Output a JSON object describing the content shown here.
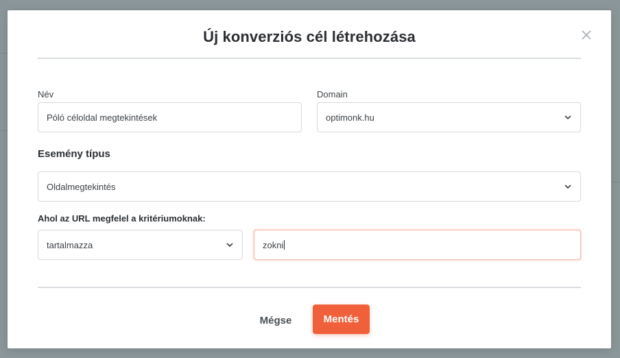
{
  "modal": {
    "title": "Új konverziós cél létrehozása",
    "close_icon": "close-icon"
  },
  "form": {
    "name": {
      "label": "Név",
      "value": "Póló céloldal megtekintések"
    },
    "domain": {
      "label": "Domain",
      "value": "optimonk.hu"
    },
    "event_type": {
      "label": "Esemény típus",
      "value": "Oldalmegtekintés"
    },
    "url_rule": {
      "label": "Ahol az URL megfelel a kritériumoknak:",
      "operator": "tartalmazza",
      "value": "zokni"
    }
  },
  "footer": {
    "cancel_label": "Mégse",
    "save_label": "Mentés"
  },
  "colors": {
    "accent": "#f0603a",
    "overlay": "#7d8b8f"
  }
}
